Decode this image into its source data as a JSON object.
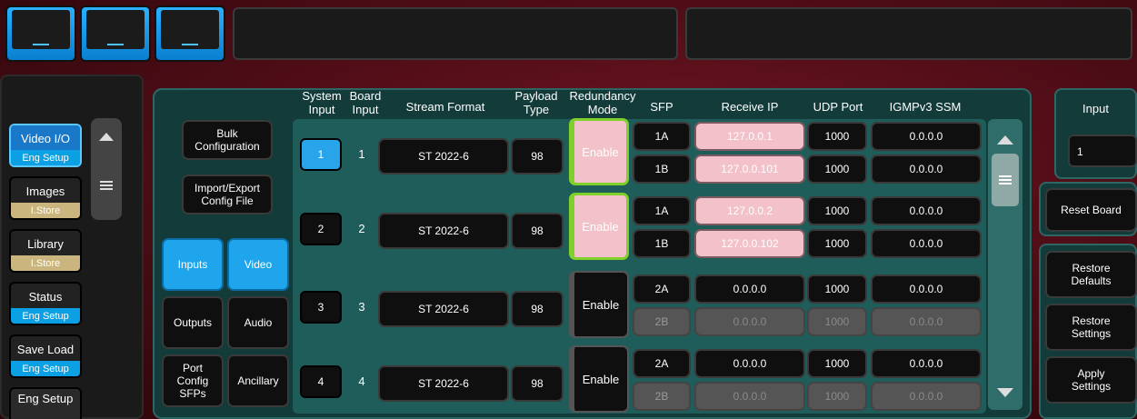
{
  "nav": {
    "items": [
      {
        "label": "Video I/O",
        "sub": "Eng Setup",
        "style": "eng",
        "active": true
      },
      {
        "label": "Images",
        "sub": "I.Store",
        "style": "store",
        "active": false
      },
      {
        "label": "Library",
        "sub": "I.Store",
        "style": "store",
        "active": false
      },
      {
        "label": "Status",
        "sub": "Eng Setup",
        "style": "eng",
        "active": false
      },
      {
        "label": "Save Load",
        "sub": "Eng Setup",
        "style": "eng",
        "active": false
      },
      {
        "label": "Eng Setup",
        "sub": "",
        "style": "plain",
        "active": false
      }
    ]
  },
  "left_buttons": {
    "bulk": "Bulk Configuration",
    "import_export": "Import/Export Config File",
    "inputs": "Inputs",
    "video": "Video",
    "outputs": "Outputs",
    "audio": "Audio",
    "port_config": "Port Config SFPs",
    "ancillary": "Ancillary"
  },
  "table": {
    "headers": {
      "system_input": "System Input",
      "board_input": "Board Input",
      "stream_format": "Stream Format",
      "payload_type": "Payload Type",
      "redundancy_mode": "Redundancy Mode",
      "sfp": "SFP",
      "receive_ip": "Receive IP",
      "udp_port": "UDP Port",
      "igmp": "IGMPv3 SSM"
    },
    "rows": [
      {
        "system": "1",
        "board": "1",
        "format": "ST 2022-6",
        "payload": "98",
        "mode": "Enable",
        "mode_on": true,
        "selected": true,
        "ports": [
          {
            "sfp": "1A",
            "ip": "127.0.0.1",
            "udp": "1000",
            "ssm": "0.0.0.0",
            "ip_style": "pink",
            "dim": false
          },
          {
            "sfp": "1B",
            "ip": "127.0.0.101",
            "udp": "1000",
            "ssm": "0.0.0.0",
            "ip_style": "pink",
            "dim": false
          }
        ]
      },
      {
        "system": "2",
        "board": "2",
        "format": "ST 2022-6",
        "payload": "98",
        "mode": "Enable",
        "mode_on": true,
        "selected": false,
        "ports": [
          {
            "sfp": "1A",
            "ip": "127.0.0.2",
            "udp": "1000",
            "ssm": "0.0.0.0",
            "ip_style": "pink",
            "dim": false
          },
          {
            "sfp": "1B",
            "ip": "127.0.0.102",
            "udp": "1000",
            "ssm": "0.0.0.0",
            "ip_style": "pink",
            "dim": false
          }
        ]
      },
      {
        "system": "3",
        "board": "3",
        "format": "ST 2022-6",
        "payload": "98",
        "mode": "Enable",
        "mode_on": false,
        "selected": false,
        "ports": [
          {
            "sfp": "2A",
            "ip": "0.0.0.0",
            "udp": "1000",
            "ssm": "0.0.0.0",
            "ip_style": "dark",
            "dim": false
          },
          {
            "sfp": "2B",
            "ip": "0.0.0.0",
            "udp": "1000",
            "ssm": "0.0.0.0",
            "ip_style": "dark",
            "dim": true
          }
        ]
      },
      {
        "system": "4",
        "board": "4",
        "format": "ST 2022-6",
        "payload": "98",
        "mode": "Enable",
        "mode_on": false,
        "selected": false,
        "ports": [
          {
            "sfp": "2A",
            "ip": "0.0.0.0",
            "udp": "1000",
            "ssm": "0.0.0.0",
            "ip_style": "dark",
            "dim": false
          },
          {
            "sfp": "2B",
            "ip": "0.0.0.0",
            "udp": "1000",
            "ssm": "0.0.0.0",
            "ip_style": "dark",
            "dim": true
          }
        ]
      }
    ]
  },
  "right": {
    "input_label": "Input",
    "input_value": "1",
    "reset_board": "Reset Board",
    "restore_defaults": "Restore Defaults",
    "restore_settings": "Restore Settings",
    "apply_settings": "Apply Settings"
  },
  "colors": {
    "background": "#5a0f1a",
    "panel": "#123b3a",
    "accent_blue": "#1ea5ec",
    "pink_field": "#f3c1c9",
    "enable_green": "#7fd12a"
  }
}
